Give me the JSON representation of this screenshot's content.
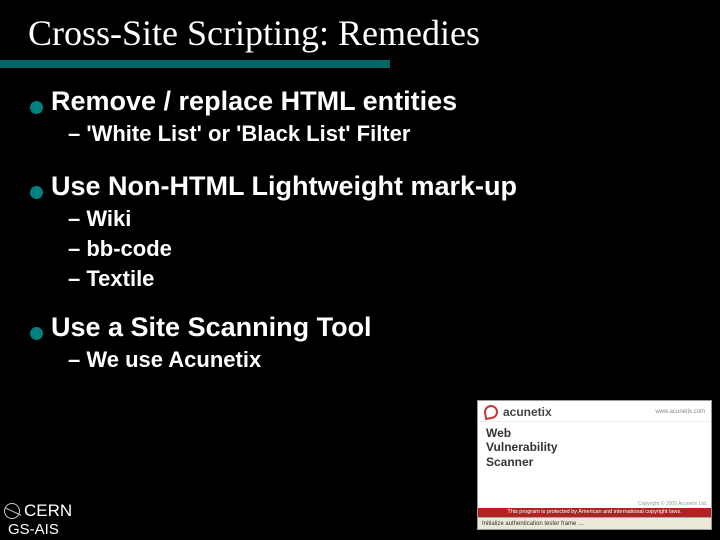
{
  "title": "Cross-Site Scripting: Remedies",
  "bullets": [
    {
      "text": "Remove / replace HTML entities",
      "subs": [
        "– 'White List' or 'Black List' Filter"
      ]
    },
    {
      "text": "Use Non-HTML Lightweight mark-up",
      "subs": [
        "– Wiki",
        "– bb-code",
        "– Textile"
      ]
    },
    {
      "text": "Use a Site Scanning Tool",
      "subs": [
        "– We use Acunetix"
      ]
    }
  ],
  "footer": {
    "org": "CERN",
    "dept": "GS-AIS"
  },
  "screenshot": {
    "brand": "acunetix",
    "url": "www.acunetix.com",
    "product_line1": "Web",
    "product_line2": "Vulnerability",
    "product_line3": "Scanner",
    "copyright": "Copyright © 2009 Acunetix Ltd.",
    "redbar": "This program is protected by American and international copyright laws.",
    "status": "Initialize authentication tester frame …"
  }
}
